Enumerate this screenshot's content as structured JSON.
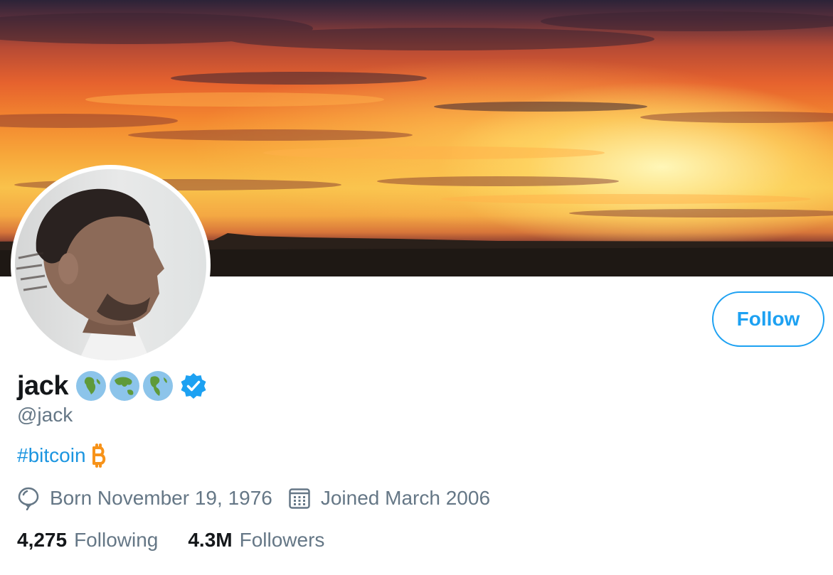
{
  "profile": {
    "display_name": "jack",
    "handle": "@jack",
    "bio": {
      "hashtag": "#bitcoin",
      "emoji_icon": "bitcoin-icon"
    },
    "name_emojis": [
      "globe-africa-icon",
      "globe-asia-icon",
      "globe-americas-icon"
    ],
    "verified_icon": "verified-badge-icon",
    "birthday": "Born November 19, 1976",
    "joined": "Joined March 2006"
  },
  "actions": {
    "follow_label": "Follow"
  },
  "stats": {
    "following_count": "4,275",
    "following_label": "Following",
    "followers_count": "4.3M",
    "followers_label": "Followers"
  },
  "colors": {
    "accent": "#1da1f2",
    "link": "#1b95e0",
    "text_primary": "#14171a",
    "text_secondary": "#657786",
    "bitcoin": "#f7931a"
  }
}
